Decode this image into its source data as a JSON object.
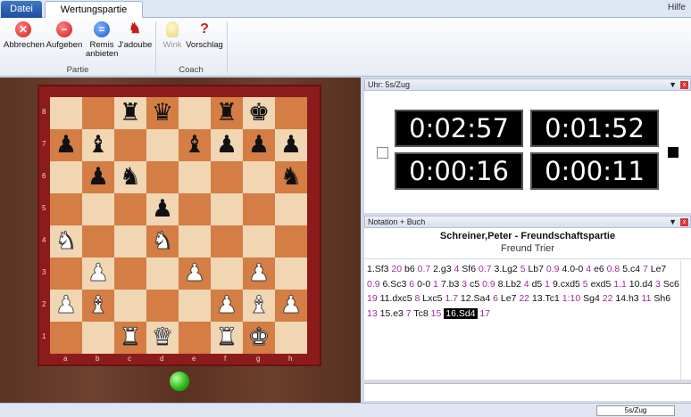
{
  "tabs": {
    "file": "Datei",
    "active": "Wertungspartie",
    "help": "Hilfe"
  },
  "ribbon": {
    "buttons": [
      {
        "label": "Abbrechen",
        "icon": "x-icon"
      },
      {
        "label": "Aufgeben",
        "icon": "minus-icon"
      },
      {
        "label": "Remis anbieten",
        "icon": "equals-icon"
      },
      {
        "label": "J'adoube",
        "icon": "adjust-icon"
      },
      {
        "label": "Wink",
        "icon": "lightbulb-icon"
      },
      {
        "label": "Vorschlag",
        "icon": "question-icon"
      }
    ],
    "groups": {
      "partie": "Partie",
      "coach": "Coach"
    }
  },
  "board": {
    "files": [
      "a",
      "b",
      "c",
      "d",
      "e",
      "f",
      "g",
      "h"
    ],
    "ranks": [
      "8",
      "7",
      "6",
      "5",
      "4",
      "3",
      "2",
      "1"
    ],
    "position": [
      [
        "",
        "",
        "bR",
        "bQ",
        "",
        "bR",
        "bK",
        ""
      ],
      [
        "bP",
        "bB",
        "",
        "",
        "bB",
        "bP",
        "bP",
        "bP"
      ],
      [
        "",
        "bP",
        "bN",
        "",
        "",
        "",
        "",
        "bN"
      ],
      [
        "",
        "",
        "",
        "bP",
        "",
        "",
        "",
        ""
      ],
      [
        "wN",
        "",
        "",
        "wN",
        "",
        "",
        "",
        ""
      ],
      [
        "",
        "wP",
        "",
        "",
        "wP",
        "",
        "wP",
        ""
      ],
      [
        "wP",
        "wB",
        "",
        "",
        "",
        "wP",
        "wB",
        "wP"
      ],
      [
        "",
        "",
        "wR",
        "wQ",
        "",
        "wR",
        "wK",
        ""
      ]
    ]
  },
  "clock_panel": {
    "title": "Uhr: 5s/Zug",
    "top_left": "0:02:57",
    "top_right": "0:01:52",
    "bottom_left": "0:00:16",
    "bottom_right": "0:00:11"
  },
  "notation_panel": {
    "title": "Notation + Buch",
    "header": "Schreiner,Peter - Freundschaftspartie",
    "subheader": "Freund Trier",
    "moves": [
      [
        "1.Sf3",
        "20"
      ],
      [
        "b6",
        "0.7"
      ],
      [
        "2.g3",
        "4"
      ],
      [
        "Sf6",
        "0.7"
      ],
      [
        "3.Lg2",
        "5"
      ],
      [
        "Lb7",
        "0.9"
      ],
      [
        "4.0-0",
        "4"
      ],
      [
        "e6",
        "0.8"
      ],
      [
        "5.c4",
        "7"
      ],
      [
        "Le7",
        "0.9"
      ],
      [
        "6.Sc3",
        "6"
      ],
      [
        "0-0",
        "1"
      ],
      [
        "7.b3",
        "3"
      ],
      [
        "c5",
        "0.9"
      ],
      [
        "8.Lb2",
        "4"
      ],
      [
        "d5",
        "1"
      ],
      [
        "9.cxd5",
        "5"
      ],
      [
        "exd5",
        "1.1"
      ],
      [
        "10.d4",
        "3"
      ],
      [
        "Sc6",
        "19"
      ],
      [
        "11.dxc5",
        "8"
      ],
      [
        "Lxc5",
        "1.7"
      ],
      [
        "12.Sa4",
        "6"
      ],
      [
        "Le7",
        "22"
      ],
      [
        "13.Tc1",
        "1:10"
      ],
      [
        "Sg4",
        "22"
      ],
      [
        "14.h3",
        "11"
      ],
      [
        "Sh6",
        "13"
      ],
      [
        "15.e3",
        "7"
      ],
      [
        "Tc8",
        "15"
      ],
      [
        "16.Sd4",
        "17"
      ]
    ],
    "highlight_index": 30
  },
  "status": {
    "field": "5s/Zug"
  },
  "colors": {
    "light_square": "#f1d6b3",
    "dark_square": "#d47d44",
    "frame": "#8c1c1c",
    "eval": "#a02aa0"
  }
}
